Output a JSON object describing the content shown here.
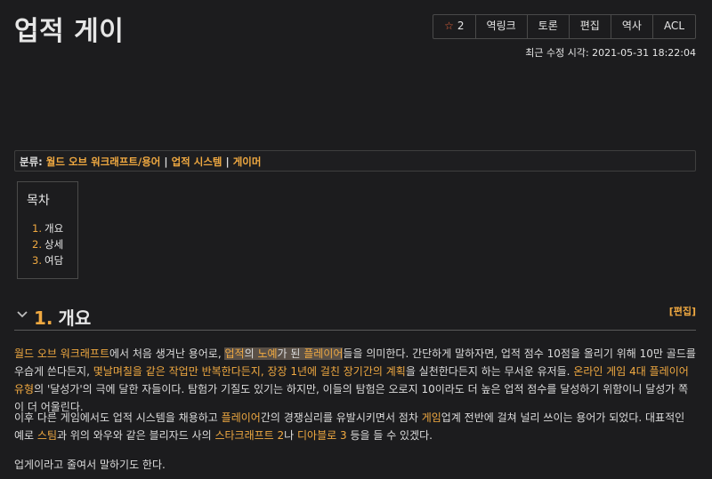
{
  "page": {
    "title": "업적 게이",
    "last_modified_label": "최근 수정 시각: 2021-05-31 18:22:04"
  },
  "toolbar": {
    "star_count": "2",
    "buttons": [
      "역링크",
      "토론",
      "편집",
      "역사",
      "ACL"
    ]
  },
  "categories": {
    "label": "분류:",
    "items": [
      "월드 오브 워크래프트/용어",
      "업적 시스템",
      "게이머"
    ]
  },
  "toc": {
    "title": "목차",
    "items": [
      {
        "num": "1.",
        "label": "개요"
      },
      {
        "num": "2.",
        "label": "상세"
      },
      {
        "num": "3.",
        "label": "여담"
      }
    ]
  },
  "section": {
    "num": "1.",
    "title": "개요",
    "edit_label": "[편집]"
  },
  "paragraphs": {
    "p1": {
      "a1": "월드 오브 워크래프트",
      "t1": "에서 처음 생겨난 용어로, ",
      "a2": "업적",
      "t2": "의 ",
      "a3": "노예",
      "t3": "가 된 ",
      "a4": "플레이어",
      "t4": "들을 의미한다. 간단하게 말하자면, 업적 점수 10점을 올리기 위해 10만 골드를 우습게 쓴다든지, ",
      "a5": "몇날며칠을 같은 작업만 반복한다든지, 장장 1년에 걸친 장기간의 계획",
      "t5": "을 실천한다든지 하는 무서운 유저들. ",
      "a6": "온라인 게임 4대 플레이어 유형",
      "t6": "의 '달성가'의 극에 달한 자들이다. 탐험가 기질도 있기는 하지만, 이들의 탐험은 오로지 10이라도 더 높은 업적 점수를 달성하기 위함이니 달성가 쪽이 더 어울린다."
    },
    "p2": {
      "t1": "이후 다른 게임에서도 업적 시스템을 채용하고 ",
      "a1": "플레이어",
      "t2": "간의 경쟁심리를 유발시키면서 점차 ",
      "a2": "게임",
      "t3": "업계 전반에 걸쳐 널리 쓰이는 용어가 되었다. 대표적인 예로 ",
      "a3": "스팀",
      "t4": "과 위의 와우와 같은 블리자드 사의 ",
      "a4": "스타크래프트 2",
      "t5": "나 ",
      "a5": "디아블로 3",
      "t6": " 등을 들 수 있겠다."
    },
    "p3": {
      "t1": "업게이라고 줄여서 말하기도 한다."
    }
  },
  "colors": {
    "background": "#1c1c1e",
    "link": "#f0a941",
    "text": "#dcdcdc",
    "star": "#e8643c"
  }
}
